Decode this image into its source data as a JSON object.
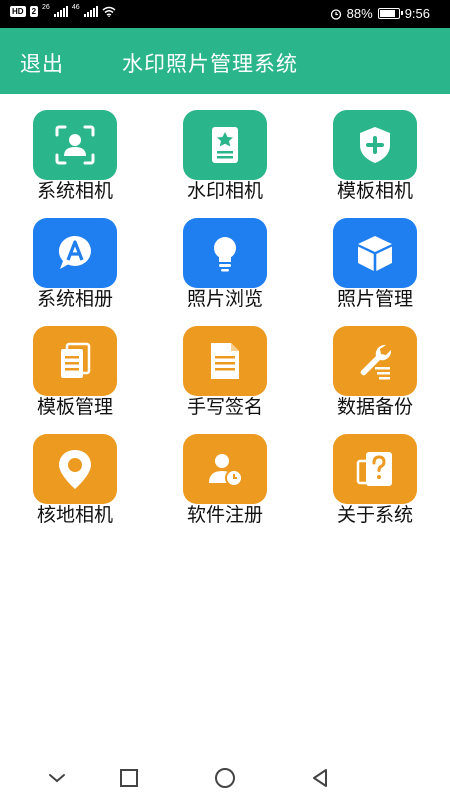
{
  "status_bar": {
    "hd_badge": "HD",
    "sim_badge": "2",
    "network_1": "26",
    "network_2": "46",
    "battery_percent": 88,
    "battery_text": "88%",
    "time": "9:56",
    "icons": [
      "signal-icon",
      "wifi-icon",
      "alarm-icon",
      "battery-icon"
    ]
  },
  "header": {
    "exit_label": "退出",
    "title": "水印照片管理系统",
    "background": "#2bb58a"
  },
  "tiles": [
    {
      "label": "系统相机",
      "icon": "face-scan-icon",
      "color": "#2bb58a"
    },
    {
      "label": "水印相机",
      "icon": "badge-star-icon",
      "color": "#2bb58a"
    },
    {
      "label": "模板相机",
      "icon": "shield-plus-icon",
      "color": "#2bb58a"
    },
    {
      "label": "系统相册",
      "icon": "chat-a-icon",
      "color": "#1f7ef0"
    },
    {
      "label": "照片浏览",
      "icon": "lightbulb-icon",
      "color": "#1f7ef0"
    },
    {
      "label": "照片管理",
      "icon": "cube-icon",
      "color": "#1f7ef0"
    },
    {
      "label": "模板管理",
      "icon": "documents-icon",
      "color": "#ec9a20"
    },
    {
      "label": "手写签名",
      "icon": "document-lines-icon",
      "color": "#ec9a20"
    },
    {
      "label": "数据备份",
      "icon": "wrench-icon",
      "color": "#ec9a20"
    },
    {
      "label": "核地相机",
      "icon": "location-pin-icon",
      "color": "#ec9a20"
    },
    {
      "label": "软件注册",
      "icon": "user-clock-icon",
      "color": "#ec9a20"
    },
    {
      "label": "关于系统",
      "icon": "question-card-icon",
      "color": "#ec9a20"
    }
  ],
  "nav": {
    "icons": [
      "back-chevron-icon",
      "recents-square-icon",
      "home-circle-icon",
      "back-triangle-icon"
    ]
  }
}
